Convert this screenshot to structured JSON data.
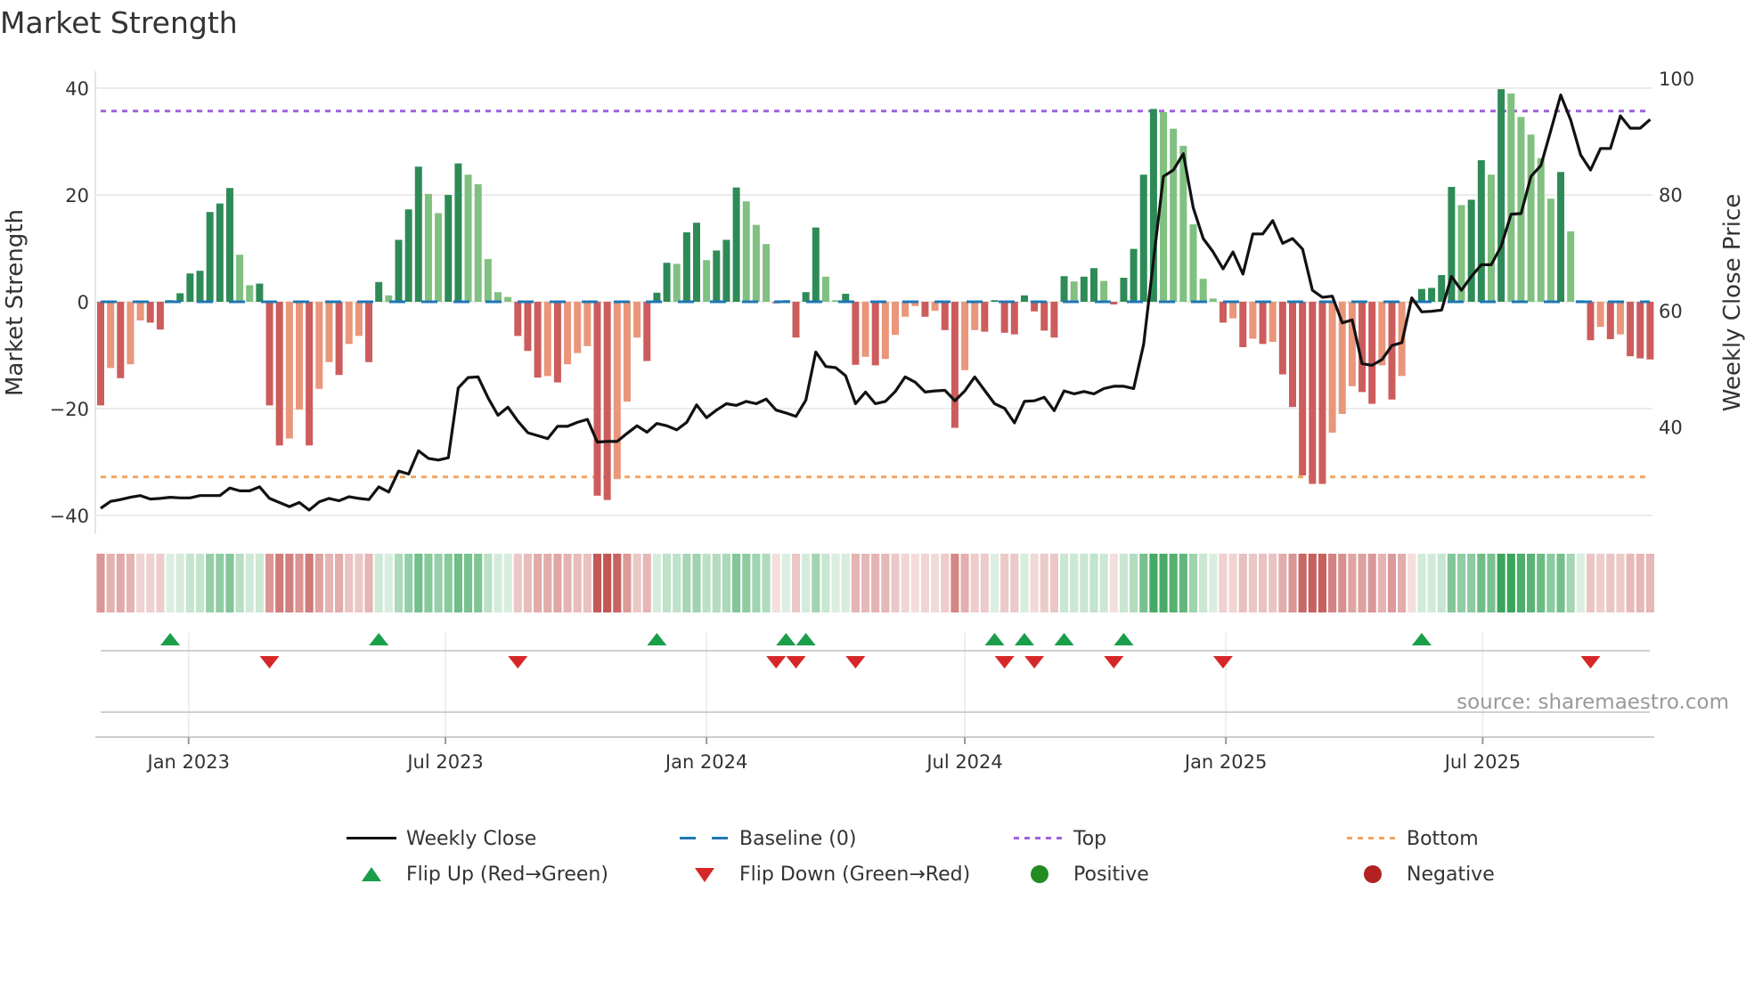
{
  "title": "Market Strength",
  "source": "source: sharemaestro.com",
  "chart_data": {
    "type": "bar+line",
    "title": "Market Strength",
    "ylabel": "Market Strength",
    "y2label": "Weekly Close Price",
    "ylim": [
      -43.5,
      43.3
    ],
    "y_ticks": [
      {
        "v": 40,
        "label": "40"
      },
      {
        "v": 20,
        "label": "20"
      },
      {
        "v": 0,
        "label": "0"
      },
      {
        "v": -20,
        "label": "−20"
      },
      {
        "v": -40,
        "label": "−40"
      }
    ],
    "y2_ticks": [
      {
        "v": 100,
        "label": "100"
      },
      {
        "v": 80,
        "label": "80"
      },
      {
        "v": 60,
        "label": "60"
      },
      {
        "v": 40,
        "label": "40"
      }
    ],
    "x_ticks": [
      {
        "date": "2023-01-01",
        "label": "Jan 2023"
      },
      {
        "date": "2023-07-01",
        "label": "Jul 2023"
      },
      {
        "date": "2024-01-01",
        "label": "Jan 2024"
      },
      {
        "date": "2024-07-01",
        "label": "Jul 2024"
      },
      {
        "date": "2025-01-01",
        "label": "Jan 2025"
      },
      {
        "date": "2025-07-01",
        "label": "Jul 2025"
      }
    ],
    "start_week": "2022-10-31",
    "frequency": "weekly",
    "top_threshold": 35.7,
    "bottom_threshold": -32.8,
    "baseline": 0,
    "grid": true,
    "legend_placement": "bottom",
    "strength": [
      -19.4,
      -12.4,
      -14.3,
      -11.7,
      -3.5,
      -3.9,
      -5.2,
      0.3,
      1.6,
      5.3,
      5.8,
      16.8,
      18.4,
      21.3,
      8.8,
      3.1,
      3.4,
      -19.4,
      -26.9,
      -25.6,
      -20.2,
      -26.9,
      -16.3,
      -11.3,
      -13.7,
      -7.9,
      -6.4,
      -11.3,
      3.7,
      1.2,
      11.6,
      17.3,
      25.3,
      20.2,
      16.6,
      20.0,
      25.9,
      23.8,
      22.0,
      8.0,
      1.8,
      0.9,
      -6.4,
      -9.2,
      -14.2,
      -13.9,
      -15.1,
      -11.7,
      -9.6,
      -8.3,
      -36.3,
      -37.1,
      -33.2,
      -18.7,
      -6.7,
      -11.1,
      1.7,
      7.3,
      7.1,
      13.0,
      14.8,
      7.8,
      9.6,
      11.6,
      21.4,
      18.8,
      14.4,
      10.8,
      -0.3,
      0.3,
      -6.7,
      1.8,
      13.9,
      4.7,
      0.3,
      1.5,
      -11.8,
      -10.3,
      -11.9,
      -10.7,
      -6.2,
      -2.8,
      -0.8,
      -2.8,
      -1.7,
      -5.3,
      -23.6,
      -12.8,
      -5.3,
      -5.6,
      0.3,
      -5.8,
      -6.1,
      1.2,
      -1.8,
      -5.4,
      -6.7,
      4.8,
      3.8,
      4.7,
      6.3,
      3.9,
      -0.5,
      4.5,
      9.9,
      23.8,
      36.1,
      35.5,
      32.4,
      29.2,
      14.5,
      4.3,
      0.6,
      -3.9,
      -3.1,
      -8.5,
      -6.9,
      -7.9,
      -7.5,
      -13.6,
      -19.7,
      -32.5,
      -34.1,
      -34.1,
      -24.5,
      -21.0,
      -15.8,
      -16.9,
      -19.1,
      -11.9,
      -18.3,
      -13.9,
      -0.3,
      2.4,
      2.6,
      5.0,
      21.5,
      18.1,
      19.1,
      26.5,
      23.8,
      39.8,
      39.0,
      34.6,
      31.3,
      26.9,
      19.3,
      24.3,
      13.2,
      0.3,
      -7.2,
      -4.7,
      -7.0,
      -6.1,
      -10.2,
      -10.6,
      -10.8
    ],
    "weekly_close": [
      26.0,
      27.2,
      27.5,
      27.9,
      28.2,
      27.6,
      27.7,
      27.9,
      27.8,
      27.8,
      28.2,
      28.2,
      28.2,
      29.5,
      29.0,
      29.0,
      29.7,
      27.7,
      27.0,
      26.3,
      27.0,
      25.7,
      27.1,
      27.7,
      27.3,
      28.0,
      27.7,
      27.5,
      29.7,
      28.8,
      32.4,
      31.9,
      35.9,
      34.6,
      34.3,
      34.7,
      46.7,
      48.5,
      48.6,
      45.0,
      42.0,
      43.4,
      41.0,
      39.0,
      38.5,
      38.0,
      40.1,
      40.1,
      40.8,
      41.3,
      37.4,
      37.5,
      37.5,
      38.9,
      40.2,
      39.1,
      40.6,
      40.2,
      39.5,
      40.8,
      43.8,
      41.6,
      42.9,
      44.0,
      43.7,
      44.4,
      44.0,
      44.8,
      42.9,
      42.4,
      41.8,
      44.6,
      52.9,
      50.4,
      50.2,
      48.8,
      44.0,
      46.0,
      44.0,
      44.4,
      46.1,
      48.6,
      47.7,
      46.0,
      46.2,
      46.3,
      44.5,
      46.2,
      48.6,
      46.3,
      44.0,
      43.2,
      40.7,
      44.4,
      44.5,
      45.1,
      42.8,
      46.2,
      45.7,
      46.1,
      45.7,
      46.6,
      47.0,
      47.0,
      46.6,
      54.2,
      68.7,
      83.1,
      84.2,
      87.0,
      77.7,
      72.4,
      70.1,
      67.2,
      70.1,
      66.3,
      73.2,
      73.2,
      75.5,
      71.6,
      72.4,
      70.6,
      63.5,
      62.3,
      62.5,
      57.9,
      58.4,
      50.9,
      50.6,
      51.6,
      54.0,
      54.5,
      62.2,
      59.8,
      59.9,
      60.1,
      65.9,
      63.5,
      65.9,
      67.9,
      67.9,
      71.1,
      76.6,
      76.7,
      83.1,
      85.0,
      91.0,
      97.1,
      92.8,
      86.8,
      84.2,
      87.9,
      87.9,
      93.5,
      91.4,
      91.4,
      92.9
    ],
    "colors": {
      "pos_rising": "#2e8b57",
      "pos_falling": "#80c080",
      "neg_falling": "#cd5c5c",
      "neg_rising": "#e9967a",
      "line": "#111111",
      "baseline": "#1f77b4",
      "top": "#a060e0",
      "bottom": "#f4a460",
      "flip_up": "#1a9e4a",
      "flip_down": "#d62728",
      "positive": "#228b22",
      "negative": "#b22222",
      "strip_pos": "#3ca55c",
      "strip_neg": "#c0504d"
    }
  },
  "legend": [
    {
      "label": "Weekly Close",
      "symbol": "line"
    },
    {
      "label": "Baseline (0)",
      "symbol": "dash"
    },
    {
      "label": "Top",
      "symbol": "dot-purple"
    },
    {
      "label": "Bottom",
      "symbol": "dot-orange"
    },
    {
      "label": "Flip Up (Red→Green)",
      "symbol": "triangle-up"
    },
    {
      "label": "Flip Down (Green→Red)",
      "symbol": "triangle-down"
    },
    {
      "label": "Positive",
      "symbol": "circle-green"
    },
    {
      "label": "Negative",
      "symbol": "circle-red"
    }
  ]
}
